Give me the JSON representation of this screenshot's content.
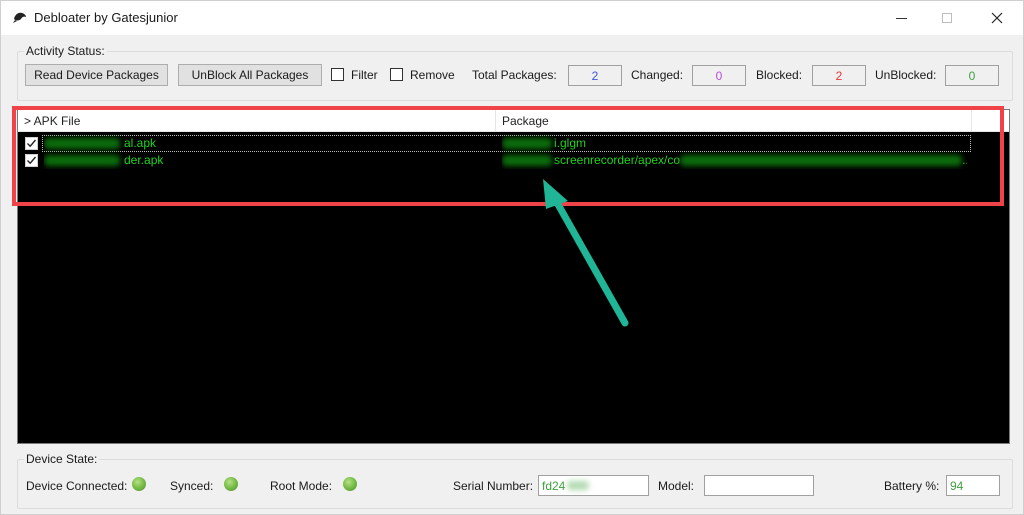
{
  "window": {
    "title": "Debloater by Gatesjunior",
    "app_icon": "debloater-logo-icon",
    "controls": {
      "minimize": "minimize-icon",
      "maximize": "maximize-icon",
      "close": "close-icon"
    }
  },
  "activity": {
    "group_label": "Activity Status:",
    "read_button": "Read Device Packages",
    "unblock_button": "UnBlock All Packages",
    "filter_label": "Filter",
    "filter_checked": false,
    "remove_label": "Remove",
    "remove_checked": false,
    "total_label": "Total Packages:",
    "total_value": "2",
    "changed_label": "Changed:",
    "changed_value": "0",
    "blocked_label": "Blocked:",
    "blocked_value": "2",
    "unblocked_label": "UnBlocked:",
    "unblocked_value": "0",
    "colors": {
      "total": "#3c55d8",
      "changed": "#b84ce0",
      "blocked": "#e8323a",
      "unblocked": "#3f9f3f"
    }
  },
  "list": {
    "columns": [
      "> APK File",
      "Package"
    ],
    "rows": [
      {
        "checked": true,
        "apk_visible": "al.apk",
        "package_visible": "i.glgm",
        "package_tail": ""
      },
      {
        "checked": true,
        "apk_visible": "der.apk",
        "package_visible": "screenrecorder/apex/co",
        "package_tail": "..."
      }
    ],
    "text_color": "#1ed41e"
  },
  "annotation": {
    "highlight_color": "#ef4349",
    "arrow_color": "#1fb596"
  },
  "device": {
    "group_label": "Device State:",
    "connected_label": "Device Connected:",
    "connected": true,
    "synced_label": "Synced:",
    "synced": true,
    "root_label": "Root Mode:",
    "root": true,
    "serial_label": "Serial Number:",
    "serial_value": "fd24",
    "model_label": "Model:",
    "model_value": "",
    "battery_label": "Battery %:",
    "battery_value": "94"
  }
}
